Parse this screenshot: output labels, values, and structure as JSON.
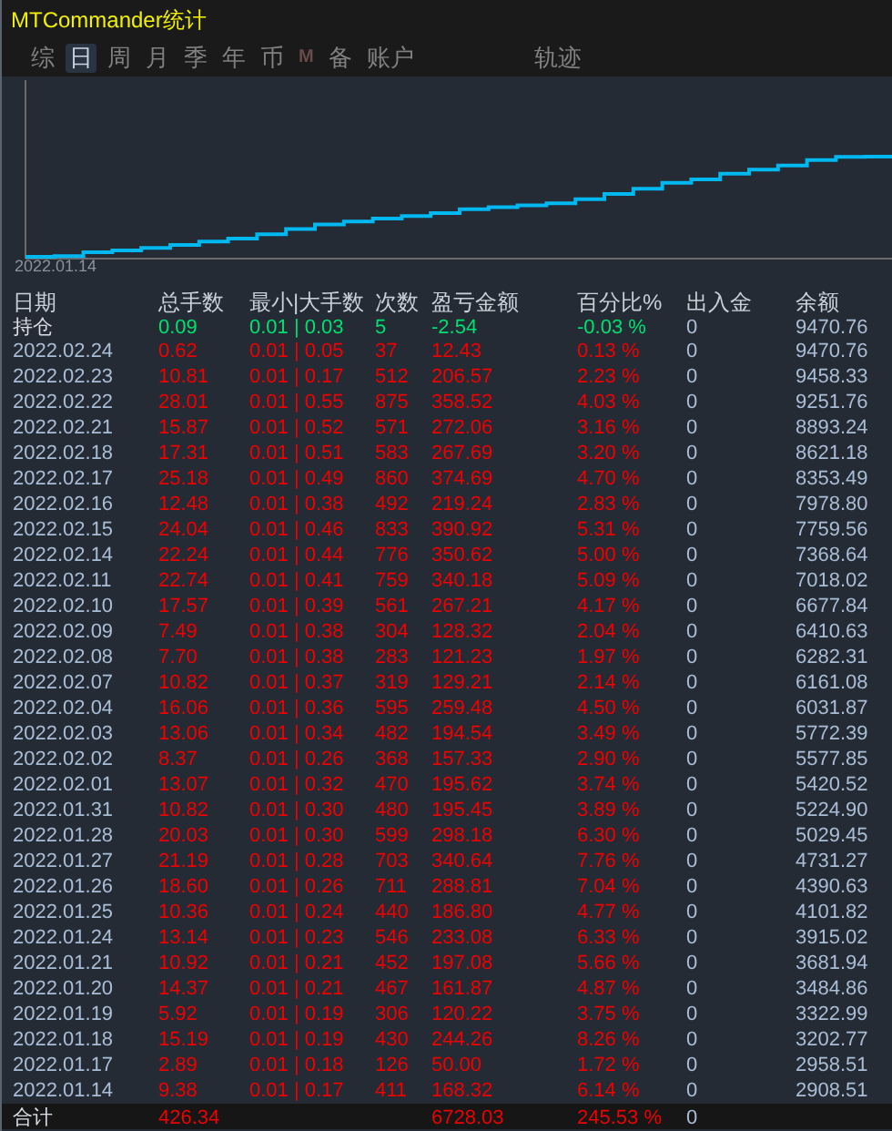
{
  "window": {
    "title": "MTCommander统计"
  },
  "tabs": [
    {
      "label": "综",
      "selected": false,
      "kind": "text"
    },
    {
      "label": "日",
      "selected": true,
      "kind": "text"
    },
    {
      "label": "周",
      "selected": false,
      "kind": "text"
    },
    {
      "label": "月",
      "selected": false,
      "kind": "text"
    },
    {
      "label": "季",
      "selected": false,
      "kind": "text"
    },
    {
      "label": "年",
      "selected": false,
      "kind": "text"
    },
    {
      "label": "币",
      "selected": false,
      "kind": "text"
    },
    {
      "label": "M",
      "selected": false,
      "kind": "mark"
    },
    {
      "label": "备",
      "selected": false,
      "kind": "text"
    },
    {
      "label": "账户",
      "selected": false,
      "kind": "text"
    },
    {
      "label": "轨迹",
      "selected": false,
      "kind": "far"
    }
  ],
  "chart": {
    "start_label": "2022.01.14"
  },
  "table": {
    "columns": [
      "日期",
      "总手数",
      "最小|大手数",
      "次数",
      "盈亏金额",
      "百分比%",
      "出入金",
      "余额"
    ],
    "holding": [
      "持仓",
      "0.09",
      "0.01 | 0.03",
      "5",
      "-2.54",
      "-0.03 %",
      "0",
      "9470.76"
    ],
    "rows": [
      [
        "2022.02.24",
        "0.62",
        "0.01 | 0.05",
        "37",
        "12.43",
        "0.13 %",
        "0",
        "9470.76"
      ],
      [
        "2022.02.23",
        "10.81",
        "0.01 | 0.17",
        "512",
        "206.57",
        "2.23 %",
        "0",
        "9458.33"
      ],
      [
        "2022.02.22",
        "28.01",
        "0.01 | 0.55",
        "875",
        "358.52",
        "4.03 %",
        "0",
        "9251.76"
      ],
      [
        "2022.02.21",
        "15.87",
        "0.01 | 0.52",
        "571",
        "272.06",
        "3.16 %",
        "0",
        "8893.24"
      ],
      [
        "2022.02.18",
        "17.31",
        "0.01 | 0.51",
        "583",
        "267.69",
        "3.20 %",
        "0",
        "8621.18"
      ],
      [
        "2022.02.17",
        "25.18",
        "0.01 | 0.49",
        "860",
        "374.69",
        "4.70 %",
        "0",
        "8353.49"
      ],
      [
        "2022.02.16",
        "12.48",
        "0.01 | 0.38",
        "492",
        "219.24",
        "2.83 %",
        "0",
        "7978.80"
      ],
      [
        "2022.02.15",
        "24.04",
        "0.01 | 0.46",
        "833",
        "390.92",
        "5.31 %",
        "0",
        "7759.56"
      ],
      [
        "2022.02.14",
        "22.24",
        "0.01 | 0.44",
        "776",
        "350.62",
        "5.00 %",
        "0",
        "7368.64"
      ],
      [
        "2022.02.11",
        "22.74",
        "0.01 | 0.41",
        "759",
        "340.18",
        "5.09 %",
        "0",
        "7018.02"
      ],
      [
        "2022.02.10",
        "17.57",
        "0.01 | 0.39",
        "561",
        "267.21",
        "4.17 %",
        "0",
        "6677.84"
      ],
      [
        "2022.02.09",
        "7.49",
        "0.01 | 0.38",
        "304",
        "128.32",
        "2.04 %",
        "0",
        "6410.63"
      ],
      [
        "2022.02.08",
        "7.70",
        "0.01 | 0.38",
        "283",
        "121.23",
        "1.97 %",
        "0",
        "6282.31"
      ],
      [
        "2022.02.07",
        "10.82",
        "0.01 | 0.37",
        "319",
        "129.21",
        "2.14 %",
        "0",
        "6161.08"
      ],
      [
        "2022.02.04",
        "16.06",
        "0.01 | 0.36",
        "595",
        "259.48",
        "4.50 %",
        "0",
        "6031.87"
      ],
      [
        "2022.02.03",
        "13.06",
        "0.01 | 0.34",
        "482",
        "194.54",
        "3.49 %",
        "0",
        "5772.39"
      ],
      [
        "2022.02.02",
        "8.37",
        "0.01 | 0.26",
        "368",
        "157.33",
        "2.90 %",
        "0",
        "5577.85"
      ],
      [
        "2022.02.01",
        "13.07",
        "0.01 | 0.32",
        "470",
        "195.62",
        "3.74 %",
        "0",
        "5420.52"
      ],
      [
        "2022.01.31",
        "10.82",
        "0.01 | 0.30",
        "480",
        "195.45",
        "3.89 %",
        "0",
        "5224.90"
      ],
      [
        "2022.01.28",
        "20.03",
        "0.01 | 0.30",
        "599",
        "298.18",
        "6.30 %",
        "0",
        "5029.45"
      ],
      [
        "2022.01.27",
        "21.19",
        "0.01 | 0.28",
        "703",
        "340.64",
        "7.76 %",
        "0",
        "4731.27"
      ],
      [
        "2022.01.26",
        "18.60",
        "0.01 | 0.26",
        "711",
        "288.81",
        "7.04 %",
        "0",
        "4390.63"
      ],
      [
        "2022.01.25",
        "10.36",
        "0.01 | 0.24",
        "440",
        "186.80",
        "4.77 %",
        "0",
        "4101.82"
      ],
      [
        "2022.01.24",
        "13.14",
        "0.01 | 0.23",
        "546",
        "233.08",
        "6.33 %",
        "0",
        "3915.02"
      ],
      [
        "2022.01.21",
        "10.92",
        "0.01 | 0.21",
        "452",
        "197.08",
        "5.66 %",
        "0",
        "3681.94"
      ],
      [
        "2022.01.20",
        "14.37",
        "0.01 | 0.21",
        "467",
        "161.87",
        "4.87 %",
        "0",
        "3484.86"
      ],
      [
        "2022.01.19",
        "5.92",
        "0.01 | 0.19",
        "306",
        "120.22",
        "3.75 %",
        "0",
        "3322.99"
      ],
      [
        "2022.01.18",
        "15.19",
        "0.01 | 0.19",
        "430",
        "244.26",
        "8.26 %",
        "0",
        "3202.77"
      ],
      [
        "2022.01.17",
        "2.89",
        "0.01 | 0.18",
        "126",
        "50.00",
        "1.72 %",
        "0",
        "2958.51"
      ],
      [
        "2022.01.14",
        "9.38",
        "0.01 | 0.17",
        "411",
        "168.32",
        "6.14 %",
        "0",
        "2908.51"
      ]
    ],
    "total": {
      "label": "合计",
      "lots": "426.34",
      "profit": "6728.03",
      "percent": "245.53 %",
      "deposit": "0"
    }
  }
}
